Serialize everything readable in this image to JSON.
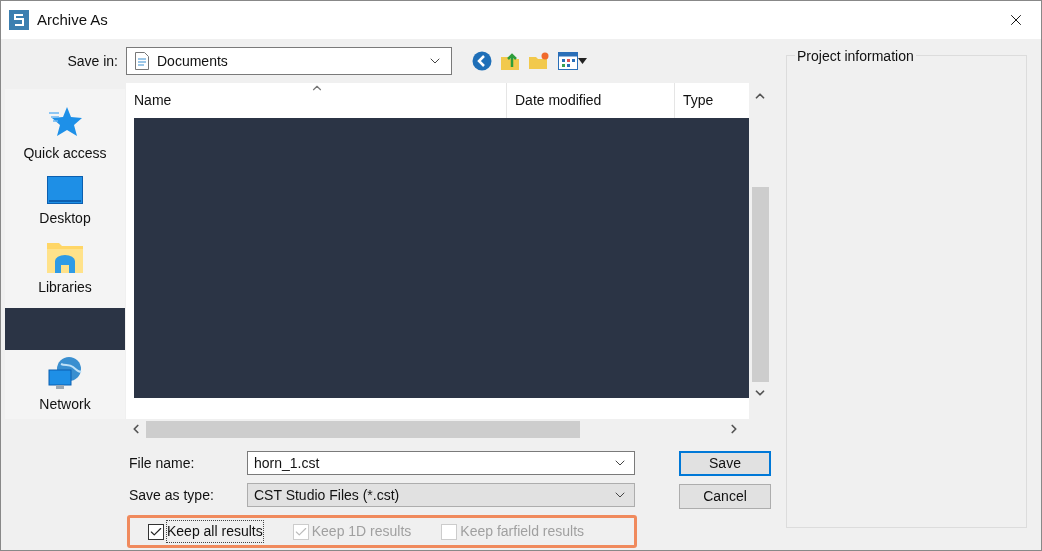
{
  "window": {
    "title": "Archive As"
  },
  "save_in": {
    "label": "Save in:",
    "value": "Documents"
  },
  "places": [
    {
      "kind": "quick-access",
      "label": "Quick access"
    },
    {
      "kind": "desktop",
      "label": "Desktop"
    },
    {
      "kind": "libraries",
      "label": "Libraries"
    },
    {
      "kind": "redacted"
    },
    {
      "kind": "network",
      "label": "Network"
    }
  ],
  "file_list": {
    "columns": [
      "Name",
      "Date modified",
      "Type"
    ],
    "rows_redacted": true
  },
  "file_name": {
    "label": "File name:",
    "value": "horn_1.cst"
  },
  "save_as_type": {
    "label": "Save as type:",
    "value": "CST Studio Files (*.cst)"
  },
  "buttons": [
    {
      "label": "Save",
      "default": true
    },
    {
      "label": "Cancel",
      "default": false
    }
  ],
  "options": [
    {
      "label": "Keep all results",
      "checked": true,
      "disabled": false
    },
    {
      "label": "Keep 1D results",
      "checked": true,
      "disabled": true
    },
    {
      "label": "Keep farfield results",
      "checked": false,
      "disabled": true
    }
  ],
  "project_info": {
    "title": "Project information"
  }
}
